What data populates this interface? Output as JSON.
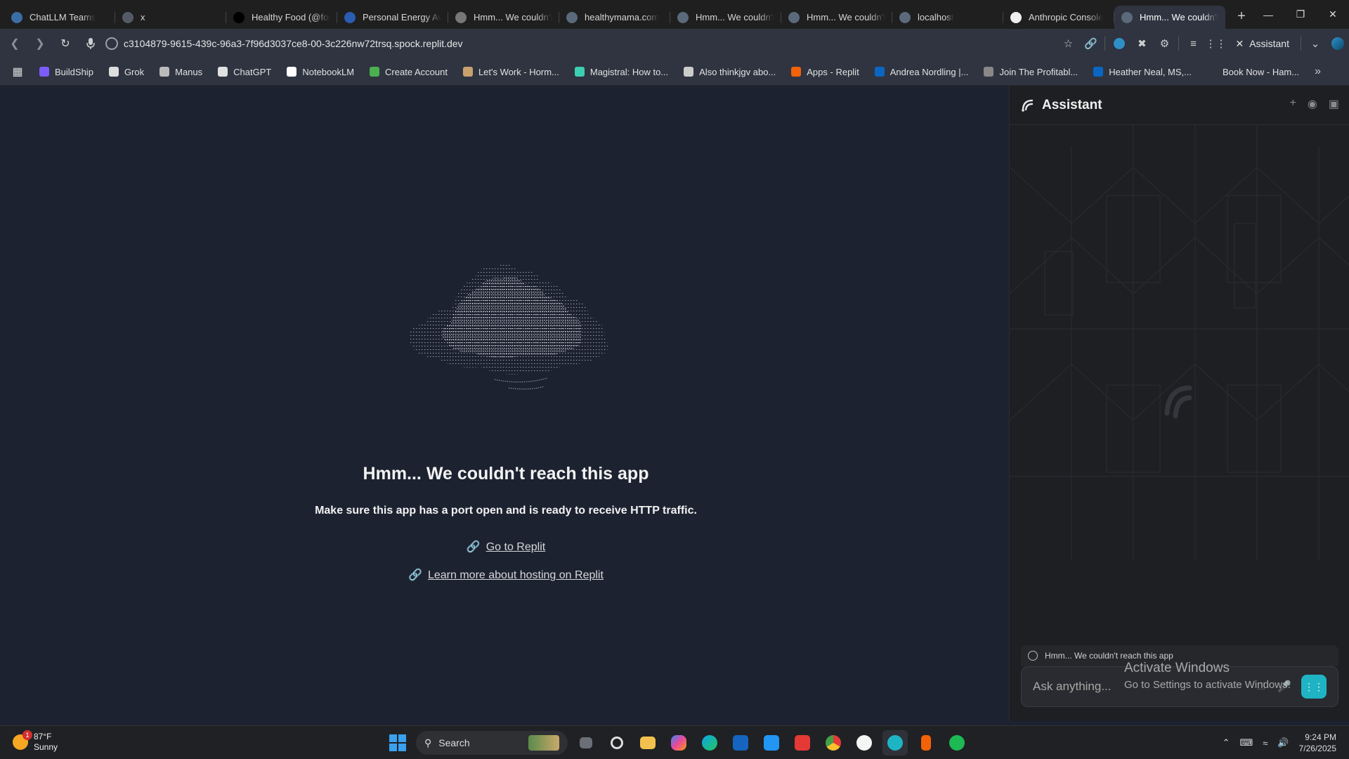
{
  "tabs": [
    {
      "label": "ChatLLM Teams",
      "icon": "chatllm-icon",
      "color": "#3b6ea5"
    },
    {
      "label": "x",
      "icon": "gear-icon",
      "color": "#555b66"
    },
    {
      "label": "Healthy Food (@foo",
      "icon": "x-logo-icon",
      "color": "#000000"
    },
    {
      "label": "Personal Energy Av",
      "icon": "bmj-icon",
      "color": "#2a5db0"
    },
    {
      "label": "Hmm... We couldn't",
      "icon": "pin-icon",
      "color": "#777777"
    },
    {
      "label": "healthymama.com",
      "icon": "globe-icon",
      "color": "#5a6a7a"
    },
    {
      "label": "Hmm... We couldn't",
      "icon": "globe-icon",
      "color": "#5a6a7a"
    },
    {
      "label": "Hmm... We couldn't",
      "icon": "globe-icon",
      "color": "#5a6a7a"
    },
    {
      "label": "localhost",
      "icon": "globe-icon",
      "color": "#5a6a7a"
    },
    {
      "label": "Anthropic Console",
      "icon": "anthropic-icon",
      "color": "#eeeeee"
    },
    {
      "label": "Hmm... We couldn't",
      "icon": "globe-icon",
      "color": "#5a6a7a",
      "active": true
    }
  ],
  "address": {
    "url": "c3104879-9615-439c-96a3-7f96d3037ce8-00-3c226nw72trsq.spock.replit.dev"
  },
  "toolbar": {
    "assistant_label": "Assistant"
  },
  "bookmarks": [
    {
      "label": "BuildShip",
      "color": "#7c5cff"
    },
    {
      "label": "Grok",
      "color": "#dddddd"
    },
    {
      "label": "Manus",
      "color": "#bbbbbb"
    },
    {
      "label": "ChatGPT",
      "color": "#e0e0e0"
    },
    {
      "label": "NotebookLM",
      "color": "#ffffff"
    },
    {
      "label": "Create Account",
      "color": "#4caf50"
    },
    {
      "label": "Let's Work - Horm...",
      "color": "#c8a16e"
    },
    {
      "label": "Magistral: How to...",
      "color": "#3ccfb0"
    },
    {
      "label": "Also thinkjgv abo...",
      "color": "#cccccc"
    },
    {
      "label": "Apps - Replit",
      "color": "#f26207"
    },
    {
      "label": "Andrea Nordling |...",
      "color": "#0a66c2"
    },
    {
      "label": "Join The Profitabl...",
      "color": "#888888"
    },
    {
      "label": "Heather Neal, MS,...",
      "color": "#0a66c2"
    },
    {
      "label": "Book Now - Ham...",
      "color": "#2f3440"
    }
  ],
  "page": {
    "title": "Hmm... We couldn't reach this app",
    "subtitle": "Make sure this app has a port open and is ready to receive HTTP traffic.",
    "link1": "Go to Replit",
    "link2": "Learn more about hosting on Replit"
  },
  "assistant": {
    "title": "Assistant",
    "context_chip": "Hmm... We couldn't reach this app",
    "placeholder": "Ask anything..."
  },
  "watermark": {
    "line1": "Activate Windows",
    "line2": "Go to Settings to activate Windows."
  },
  "taskbar": {
    "temp": "87°F",
    "condition": "Sunny",
    "weather_badge": "1",
    "search_label": "Search",
    "time": "9:24 PM",
    "date": "7/26/2025"
  }
}
